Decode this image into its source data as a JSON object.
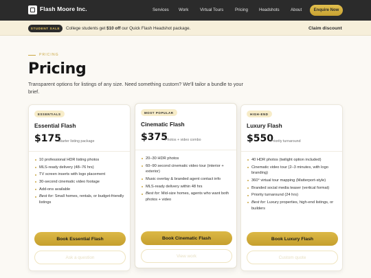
{
  "nav": {
    "brand": "Flash Moore Inc.",
    "links": [
      "Services",
      "Work",
      "Virtual Tours",
      "Pricing",
      "Headshots",
      "About"
    ],
    "cta": "Enquire Now"
  },
  "promo": {
    "badge": "STUDENT SALE",
    "text_before": "College students get ",
    "text_bold": "$10 off",
    "text_after": " our Quick Flash Headshot package.",
    "link": "Claim discount"
  },
  "header": {
    "eyebrow": "PRICING",
    "title": "Pricing",
    "subtitle": "Transparent options for listings of any size. Need something custom? We'll tailor a bundle to your brief."
  },
  "cards": [
    {
      "tier": "ESSENTIALS",
      "name": "Essential Flash",
      "price": "$175",
      "price_note": "Starter listing package",
      "features": [
        {
          "text": "10 professional HDR listing photos"
        },
        {
          "text": "MLS-ready delivery (48–76 hrs)"
        },
        {
          "text": "TV screen inserts with logo placement"
        },
        {
          "text": "30-second cinematic video footage"
        },
        {
          "text": "Add-ons available"
        },
        {
          "lead": "Best for:",
          "text": " Small homes, rentals, or budget-friendly listings"
        }
      ],
      "primary_button": "Book Essential Flash",
      "secondary_button": "Ask a question"
    },
    {
      "tier": "MOST POPULAR",
      "name": "Cinematic Flash",
      "price": "$375",
      "price_note": "Photos + video combo",
      "features": [
        {
          "text": "20–30 HDR photos"
        },
        {
          "text": "60–90 second cinematic video tour (interior + exterior)"
        },
        {
          "text": "Music overlay & branded agent contact info"
        },
        {
          "text": "MLS-ready delivery within 48 hrs"
        },
        {
          "lead": "Best for:",
          "text": " Mid-size homes, agents who want both photos + video"
        }
      ],
      "primary_button": "Book Cinematic Flash",
      "secondary_button": "View work"
    },
    {
      "tier": "HIGH-END",
      "name": "Luxury Flash",
      "price": "$550",
      "price_note": "Priority turnaround",
      "features": [
        {
          "text": "40 HDR photos (twilight option included)"
        },
        {
          "text": "Cinematic video tour (2–3 minutes, with logo branding)"
        },
        {
          "text": "360° virtual tour mapping (Matterport-style)"
        },
        {
          "text": "Branded social media teaser (vertical format)"
        },
        {
          "text": "Priority turnaround (24 hrs)"
        },
        {
          "lead": "Best for:",
          "text": " Luxury properties, high-end listings, or builders"
        }
      ],
      "primary_button": "Book Luxury Flash",
      "secondary_button": "Custom quote"
    }
  ],
  "colors": {
    "accent_gold": "#c9a640",
    "nav_bg": "#2b2b2b",
    "promo_bg": "#f6efda",
    "page_bg": "#fbf9f4"
  }
}
